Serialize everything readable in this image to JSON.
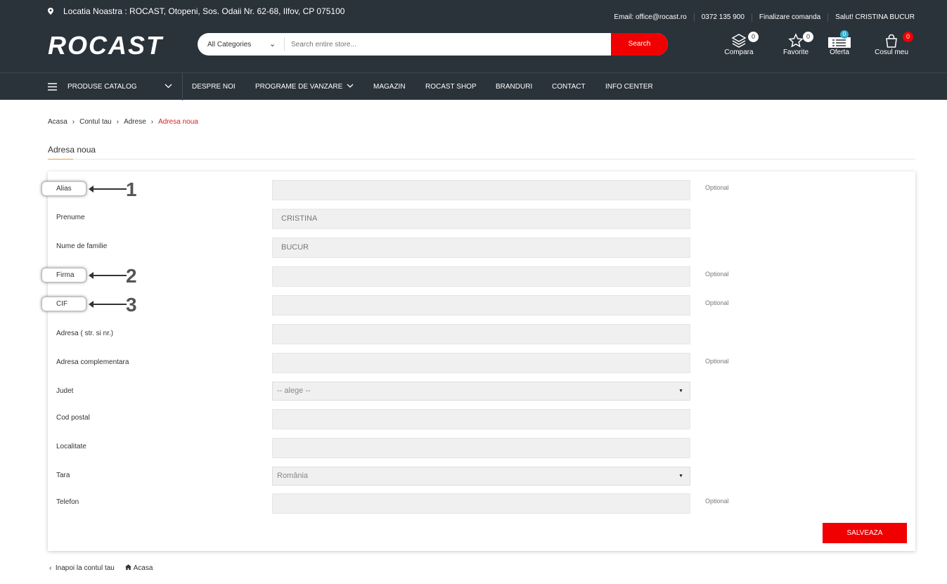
{
  "topbar": {
    "location": "Locatia Noastra : ROCAST, Otopeni, Sos. Odaii Nr. 62-68, Ilfov, CP 075100",
    "email": "Email: office@rocast.ro",
    "phone": "0372 135 900",
    "checkout": "Finalizare comanda",
    "greeting": "Salut! CRISTINA BUCUR"
  },
  "header": {
    "logo": "ROCAST",
    "category": "All Categories",
    "search_placeholder": "Search entire store...",
    "search_button": "Search",
    "icons": [
      {
        "label": "Compara",
        "count": "0",
        "icon": "layers-icon"
      },
      {
        "label": "Favorite",
        "count": "0",
        "icon": "star-icon"
      },
      {
        "label": "Oferta",
        "count": "0",
        "icon": "list-icon"
      },
      {
        "label": "Cosul meu",
        "count": "0",
        "icon": "bag-icon"
      }
    ]
  },
  "nav": {
    "catalog": "PRODUSE CATALOG",
    "items": [
      "DESPRE NOI",
      "PROGRAME DE VANZARE",
      "MAGAZIN",
      "ROCAST SHOP",
      "BRANDURI",
      "CONTACT",
      "INFO CENTER"
    ]
  },
  "breadcrumb": [
    "Acasa",
    "Contul tau",
    "Adrese",
    "Adresa noua"
  ],
  "page_title": "Adresa noua",
  "form": {
    "fields": [
      {
        "label": "Alias",
        "value": "",
        "optional": "Optional"
      },
      {
        "label": "Prenume",
        "value": "CRISTINA"
      },
      {
        "label": "Nume de familie",
        "value": "BUCUR"
      },
      {
        "label": "Firma",
        "value": "",
        "optional": "Optional"
      },
      {
        "label": "CIF",
        "value": "",
        "optional": "Optional"
      },
      {
        "label": "Adresa ( str. si nr.)",
        "value": ""
      },
      {
        "label": "Adresa complementara",
        "value": "",
        "optional": "Optional"
      },
      {
        "label": "Judet",
        "value": "-- alege --"
      },
      {
        "label": "Cod postal",
        "value": ""
      },
      {
        "label": "Localitate",
        "value": ""
      },
      {
        "label": "Tara",
        "value": "România"
      },
      {
        "label": "Telefon",
        "value": "",
        "optional": "Optional"
      }
    ],
    "save": "SALVEAZA"
  },
  "annotations": [
    "1",
    "2",
    "3"
  ],
  "footer": {
    "back": "Inapoi la contul tau",
    "home": "Acasa"
  },
  "colors": {
    "dark": "#2a323a",
    "accent": "#f00000"
  }
}
